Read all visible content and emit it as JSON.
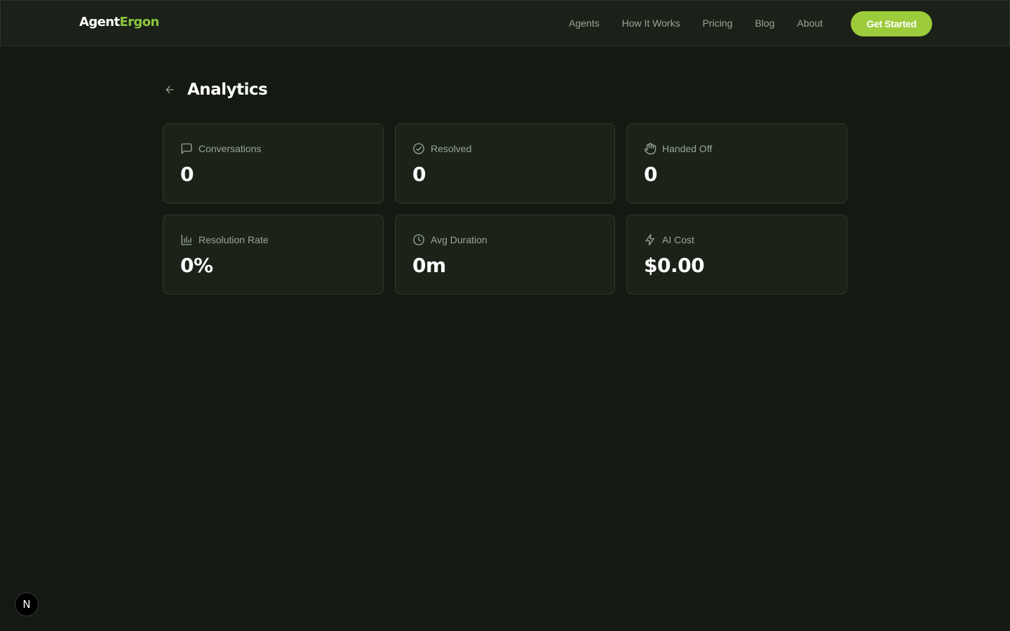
{
  "nav": {
    "logo_part1": "Agent",
    "logo_part2": "Ergon",
    "links": [
      "Agents",
      "How It Works",
      "Pricing",
      "Blog",
      "About"
    ],
    "cta_label": "Get Started"
  },
  "page": {
    "title": "Analytics"
  },
  "stats": [
    {
      "label": "Conversations",
      "value": "0",
      "icon": "message-square-icon"
    },
    {
      "label": "Resolved",
      "value": "0",
      "icon": "check-circle-icon"
    },
    {
      "label": "Handed Off",
      "value": "0",
      "icon": "hand-icon"
    },
    {
      "label": "Resolution Rate",
      "value": "0%",
      "icon": "bar-chart-icon"
    },
    {
      "label": "Avg Duration",
      "value": "0m",
      "icon": "clock-icon"
    },
    {
      "label": "AI Cost",
      "value": "$0.00",
      "icon": "zap-icon"
    }
  ],
  "devtools": {
    "badge": "N"
  },
  "colors": {
    "background": "#141912",
    "accent": "#8cc63f",
    "cta": "#9ccb3b",
    "card": "#1b2318",
    "muted_text": "#9ba793"
  }
}
